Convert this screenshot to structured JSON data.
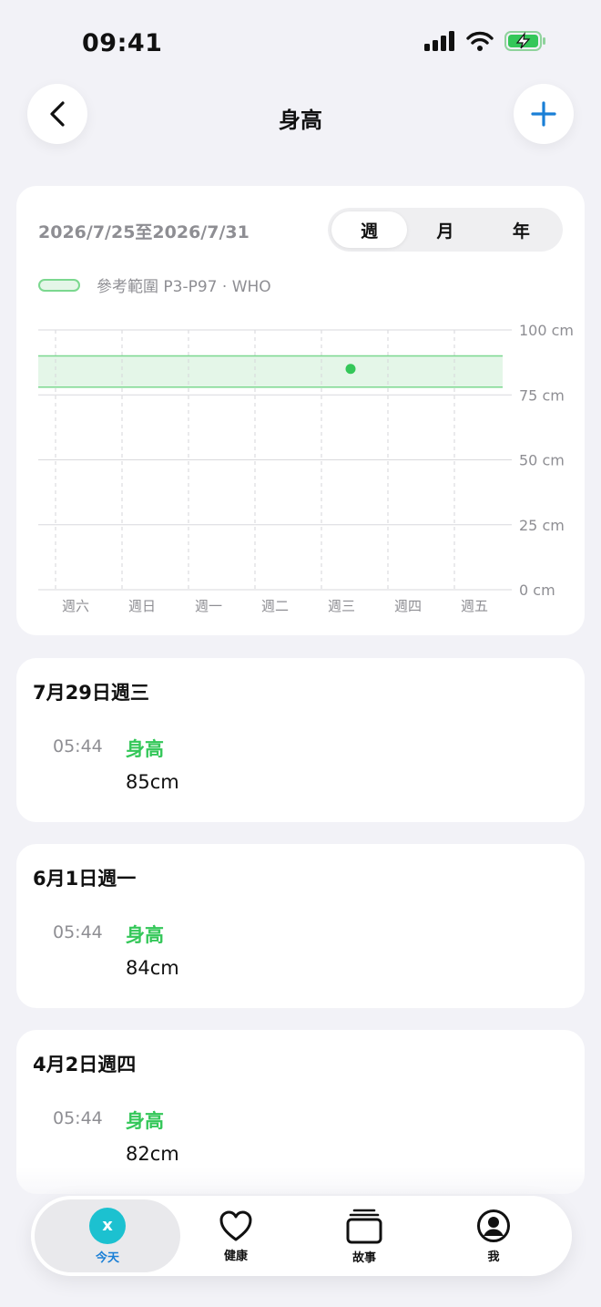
{
  "status": {
    "time": "09:41"
  },
  "header": {
    "title": "身高"
  },
  "chart_card": {
    "date_range": "2026/7/25至2026/7/31",
    "segments": [
      "週",
      "月",
      "年"
    ],
    "active_segment": "週",
    "legend": "參考範圍 P3-P97 · WHO"
  },
  "chart_data": {
    "type": "scatter",
    "categories": [
      "週六",
      "週日",
      "週一",
      "週二",
      "週三",
      "週四",
      "週五"
    ],
    "y_ticks": [
      "100 cm",
      "75 cm",
      "50 cm",
      "25 cm",
      "0 cm"
    ],
    "y_tick_values": [
      100,
      75,
      50,
      25,
      0
    ],
    "ylim": [
      0,
      100
    ],
    "reference_band": {
      "low": 78,
      "high": 90
    },
    "points": [
      {
        "x": "週三",
        "y": 85
      }
    ],
    "colors": {
      "band_fill": "#e4f6e8",
      "band_line": "#7bd88f",
      "point": "#34c759"
    }
  },
  "records": [
    {
      "date": "7月29日週三",
      "time": "05:44",
      "type": "身高",
      "value": "85cm"
    },
    {
      "date": "6月1日週一",
      "time": "05:44",
      "type": "身高",
      "value": "84cm"
    },
    {
      "date": "4月2日週四",
      "time": "05:44",
      "type": "身高",
      "value": "82cm"
    }
  ],
  "tabbar": {
    "today_icon_letter": "x",
    "tabs": [
      "今天",
      "健康",
      "故事",
      "我"
    ]
  },
  "colors": {
    "accent": "#1a7fd6",
    "green": "#34c759",
    "today_icon": "#1cc1d0"
  }
}
